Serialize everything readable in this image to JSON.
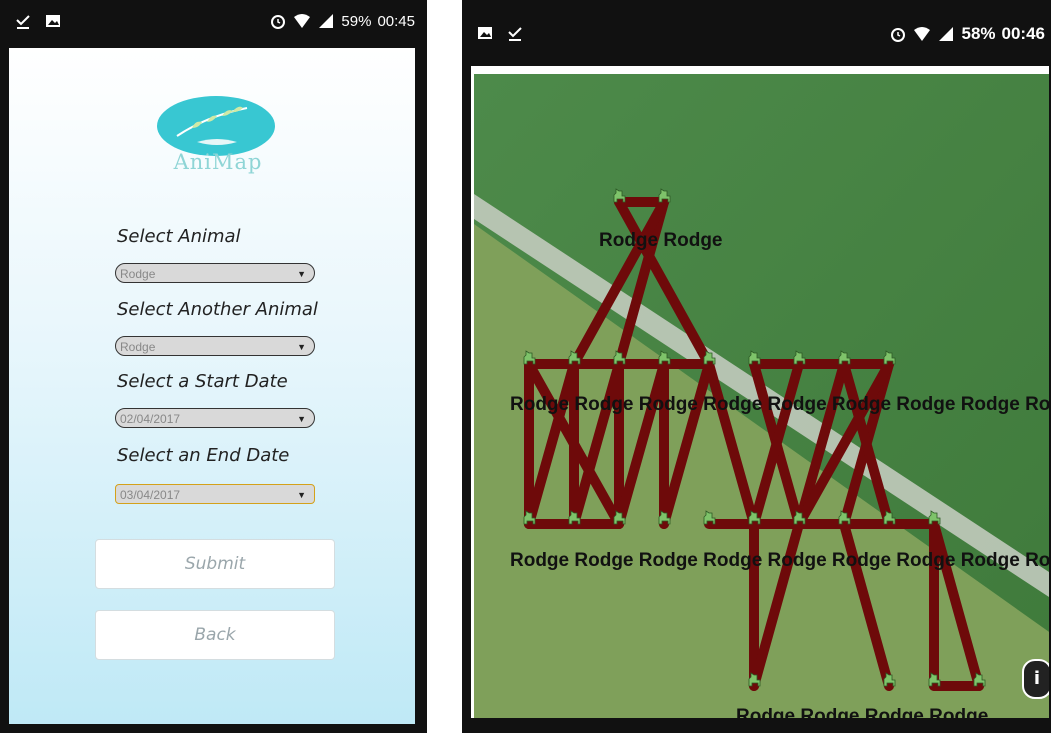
{
  "left_screen": {
    "status_bar": {
      "left_icons": [
        "download-done-icon",
        "image-icon"
      ],
      "right_icons": [
        "alarm-icon",
        "wifi-icon",
        "signal-icon"
      ],
      "battery": "59%",
      "time": "00:45"
    },
    "logo_text": "AniMap",
    "form": {
      "animal_label": "Select Animal",
      "animal_value": "Rodge",
      "another_animal_label": "Select Another Animal",
      "another_animal_value": "Rodge",
      "start_date_label": "Select a Start Date",
      "start_date_value": "02/04/2017",
      "end_date_label": "Select an End Date",
      "end_date_value": "03/04/2017",
      "submit_label": "Submit",
      "back_label": "Back"
    },
    "colors": {
      "background_bottom": "#bfe9f6",
      "logo": "#38c7d2",
      "focus_border": "#d4a11a"
    }
  },
  "right_screen": {
    "status_bar": {
      "left_icons": [
        "image-icon",
        "download-done-icon"
      ],
      "right_icons": [
        "alarm-icon",
        "wifi-icon",
        "signal-icon"
      ],
      "battery": "58%",
      "time": "00:46"
    },
    "map": {
      "marker_icon": "dog-icon",
      "marker_label": "Rodge",
      "path_color": "#6e0a0a",
      "marker_color": "#7ec36a",
      "top_label_row": "Rodge Rodge",
      "mid_label_row": "Rodge Rodge Rodge Rodge Rodge Rodge Rodge Rodge Rodge",
      "low_label_row": "Rodge Rodge Rodge Rodge Rodge Rodge Rodge Rodge Rodge Rodge",
      "bottom_label_row": "Rodge Rodge Rodge Rodge"
    },
    "info_button_label": "i"
  }
}
